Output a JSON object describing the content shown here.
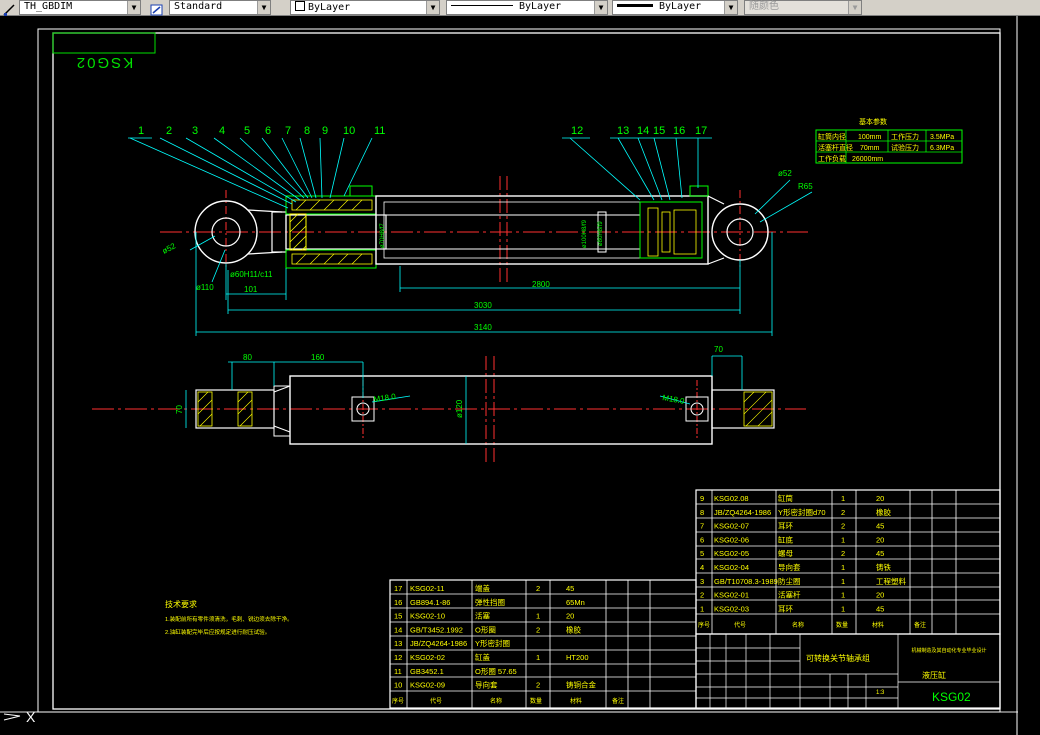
{
  "toolbar": {
    "dimstyle_value": "TH_GBDIM",
    "textstyle_value": "Standard",
    "layer_value": "ByLayer",
    "linetype_value": "ByLayer",
    "lineweight_value": "ByLayer",
    "plotstyle_value": "随颜色"
  },
  "drawing": {
    "frame_code": "KSG02",
    "balloons": [
      "1",
      "2",
      "3",
      "4",
      "5",
      "6",
      "7",
      "8",
      "9",
      "10",
      "11",
      "12",
      "13",
      "14",
      "15",
      "16",
      "17"
    ],
    "dims": {
      "d_52_left": "ø52",
      "d_110": "ø110",
      "d_60h11": "ø60H11/c11",
      "d_101": "101",
      "d_2800": "2800",
      "d_3030": "3030",
      "d_3140": "3140",
      "d_52_right": "ø52",
      "r_65": "R65",
      "d_80": "80",
      "d_160": "160",
      "d_70_top": "70",
      "d_70_side": "70",
      "m18_left": "M18.0",
      "m18_right": "M18.0",
      "d_120": "ø120",
      "rod_fit": "ø70H8/f7",
      "bore_fit_a": "ø100H8/f9",
      "bore_fit_b": "ø80H8/f9"
    },
    "params": {
      "title": "基本参数",
      "rows": [
        [
          "缸筒内径",
          "100mm",
          "工作压力",
          "3.5MPa"
        ],
        [
          "活塞杆直径",
          "70mm",
          "试验压力",
          "6.3MPa"
        ],
        [
          "工作负载",
          "26000mm",
          "",
          ""
        ]
      ]
    },
    "tech_req": {
      "title": "技术要求",
      "lines": [
        "1.装配前所有零件须清洗，毛刺、锐边须去除干净。",
        "2.油缸装配完毕后应按规定进行耐压试验。"
      ]
    },
    "parts_table_left": [
      [
        "17",
        "KSG02-11",
        "端盖",
        "2",
        "45"
      ],
      [
        "16",
        "GB894.1-86",
        "弹性挡圈",
        "",
        "65Mn"
      ],
      [
        "15",
        "KSG02-10",
        "活塞",
        "1",
        "20"
      ],
      [
        "14",
        "GB/T3452.1992",
        "O形圈",
        "2",
        "橡胶"
      ],
      [
        "13",
        "JB/ZQ4264-1986",
        "Y形密封圈",
        "",
        ""
      ],
      [
        "12",
        "KSG02-02",
        "缸盖",
        "1",
        "HT200"
      ],
      [
        "11",
        "GB3452.1",
        "O形圈 57.65",
        "",
        ""
      ],
      [
        "10",
        "KSG02-09",
        "导向套",
        "2",
        "铸铜合金"
      ]
    ],
    "parts_table_right": [
      [
        "9",
        "KSG02.08",
        "缸筒",
        "1",
        "20"
      ],
      [
        "8",
        "JB/ZQ4264-1986",
        "Y形密封圈d70",
        "2",
        "橡胶"
      ],
      [
        "7",
        "KSG02-07",
        "耳环",
        "2",
        "45"
      ],
      [
        "6",
        "KSG02-06",
        "缸底",
        "1",
        "20"
      ],
      [
        "5",
        "KSG02-05",
        "螺母",
        "2",
        "45"
      ],
      [
        "4",
        "KSG02-04",
        "导向套",
        "1",
        "铸铁"
      ],
      [
        "3",
        "GB/T10708.3-1989",
        "防尘圈",
        "1",
        "工程塑料"
      ],
      [
        "2",
        "KSG02-01",
        "活塞杆",
        "1",
        "20"
      ],
      [
        "1",
        "KSG02-03",
        "耳环",
        "1",
        "45"
      ]
    ],
    "header_left": [
      "序号",
      "代号",
      "名称",
      "数量",
      "材料",
      "备注"
    ],
    "header_right": [
      "序号",
      "代号",
      "名称",
      "数量",
      "材料",
      "备注"
    ],
    "title_block": {
      "title": "可转换关节轴承组",
      "school": "机械制造及其自动化专业毕业设计",
      "name": "液压缸",
      "code": "KSG02",
      "scale": "1:3"
    },
    "cmd_axis": "X"
  }
}
